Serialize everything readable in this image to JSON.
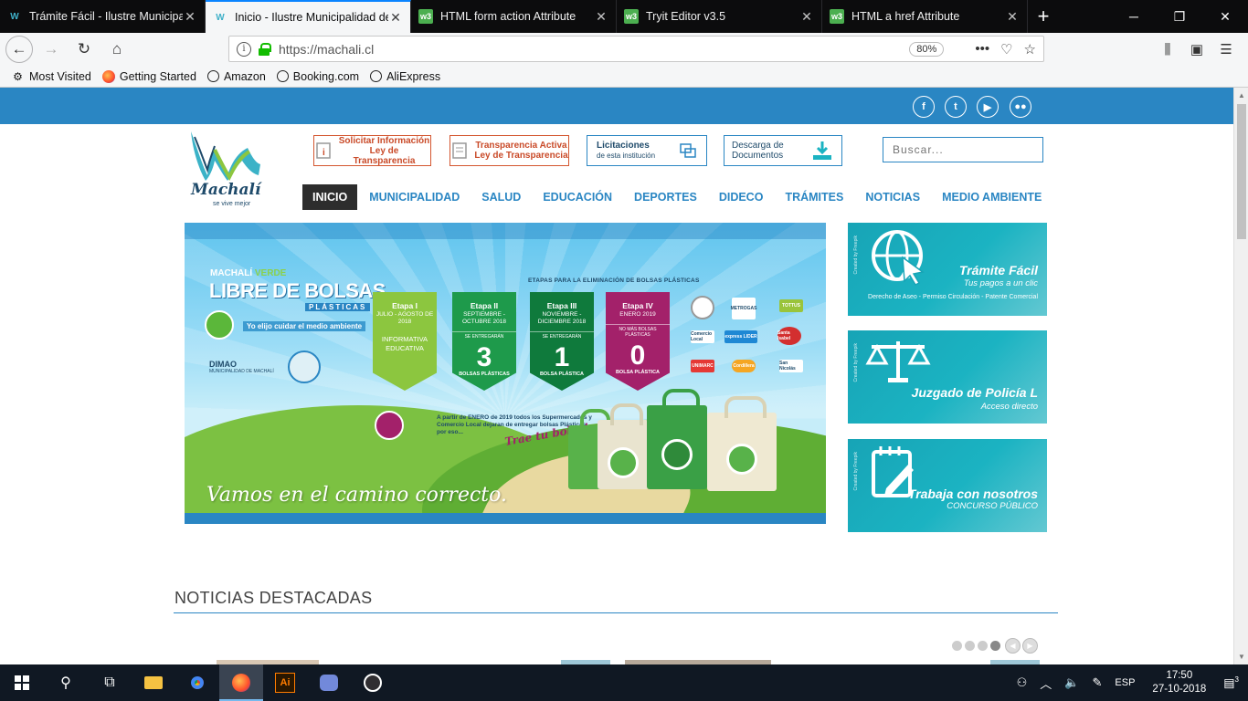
{
  "browser": {
    "tabs": [
      {
        "title": "Trámite Fácil - Ilustre Municipalidad",
        "favicon": "machali-favicon",
        "active": false
      },
      {
        "title": "Inicio - Ilustre Municipalidad de Machalí",
        "favicon": "machali-favicon",
        "active": true
      },
      {
        "title": "HTML form action Attribute",
        "favicon": "w3schools-favicon",
        "active": false
      },
      {
        "title": "Tryit Editor v3.5",
        "favicon": "w3schools-favicon",
        "active": false
      },
      {
        "title": "HTML a href Attribute",
        "favicon": "w3schools-favicon",
        "active": false
      }
    ],
    "url": "https://machali.cl",
    "zoom": "80%",
    "bookmarks": [
      "Most Visited",
      "Getting Started",
      "Amazon",
      "Booking.com",
      "AliExpress"
    ]
  },
  "site": {
    "logo": {
      "name": "Machalí",
      "tagline": "se vive mejor"
    },
    "social": [
      "f",
      "t",
      "yt",
      "fl"
    ],
    "header_links": [
      {
        "line1": "Solicitar Información",
        "line2": "Ley de Transparencia",
        "style": "red"
      },
      {
        "line1": "Transparencia Activa",
        "line2": "Ley de Transparencia",
        "style": "red"
      },
      {
        "line1": "Licitaciones",
        "line2": "de esta institución",
        "style": "blue"
      },
      {
        "line1": "Descarga de",
        "line2": "Documentos",
        "style": "blue"
      }
    ],
    "search_placeholder": "Buscar...",
    "nav": [
      "INICIO",
      "MUNICIPALIDAD",
      "SALUD",
      "EDUCACIÓN",
      "DEPORTES",
      "DIDECO",
      "TRÁMITES",
      "NOTICIAS",
      "MEDIO AMBIENTE"
    ],
    "nav_active": "INICIO",
    "banner": {
      "brand_left": "MACHALÍ",
      "brand_right": "VERDE",
      "title": "LIBRE DE BOLSAS",
      "subtitle": "PLÁSTICAS",
      "motto": "Yo elijo cuidar el medio ambiente",
      "dimao": "DIMAO",
      "dimao_sub": "MUNICIPALIDAD DE MACHALÍ",
      "etapas_label": "ETAPAS PARA LA ELIMINACIÓN DE BOLSAS PLÁSTICAS",
      "stages": [
        {
          "title": "Etapa I",
          "dates": "JULIO - AGOSTO DE 2018",
          "info": "INFORMATIVA EDUCATIVA",
          "number": "",
          "unit": "",
          "entregaran": "",
          "color": "#8cc63f"
        },
        {
          "title": "Etapa II",
          "dates": "SEPTIEMBRE - OCTUBRE 2018",
          "info": "",
          "number": "3",
          "unit": "BOLSAS PLÁSTICAS",
          "entregaran": "SE ENTREGARÁN",
          "color": "#1e9a4b"
        },
        {
          "title": "Etapa III",
          "dates": "NOVIEMBRE - DICIEMBRE 2018",
          "info": "",
          "number": "1",
          "unit": "BOLSA PLÁSTICA",
          "entregaran": "SE ENTREGARÁN",
          "color": "#0f7a3c"
        },
        {
          "title": "Etapa IV",
          "dates": "ENERO 2019",
          "info": "",
          "number": "0",
          "unit": "BOLSA PLÁSTICA",
          "entregaran": "NO MÁS BOLSAS PLÁSTICAS",
          "color": "#a3216a"
        }
      ],
      "stores": [
        "METROGAS",
        "TOTTUS",
        "Comercio Local",
        "express LIDER",
        "Santa Isabel",
        "UNIMARC",
        "Cordillera",
        "San Nicolás"
      ],
      "note": "A partir de ENERO de 2019 todos los Supermercados y Comercio Local dejaran de entregar bolsas Plásticas, por eso...",
      "trae": "Trae tu bolsa!",
      "slogan": "Vamos en el camino correcto."
    },
    "cards": [
      {
        "title": "Trámite Fácil",
        "subtitle": "Tus pagos a un clic",
        "detail": "Derecho de Aseo - Permiso Circulación - Patente Comercial",
        "credit": "Created by Freepik"
      },
      {
        "title": "Juzgado de Policía L",
        "subtitle": "Acceso directo",
        "detail": "",
        "credit": "Created by Freepik"
      },
      {
        "title": "Trabaja con nosotros",
        "subtitle": "CONCURSO PÚBLICO",
        "detail": "",
        "credit": "Created by Freepik"
      }
    ],
    "noticias_title": "NOTICIAS DESTACADAS",
    "carousel_dots": 4,
    "carousel_active": 3
  },
  "taskbar": {
    "apps": [
      "start",
      "search",
      "task-view",
      "file-explorer",
      "chrome",
      "firefox",
      "illustrator",
      "discord",
      "obs"
    ],
    "lang": "ESP",
    "time": "17:50",
    "date": "27-10-2018",
    "notifications": "3"
  },
  "colors": {
    "brand_blue": "#2a86c3",
    "teal": "#1bb3c2",
    "dark_nav": "#2d2d2d"
  }
}
